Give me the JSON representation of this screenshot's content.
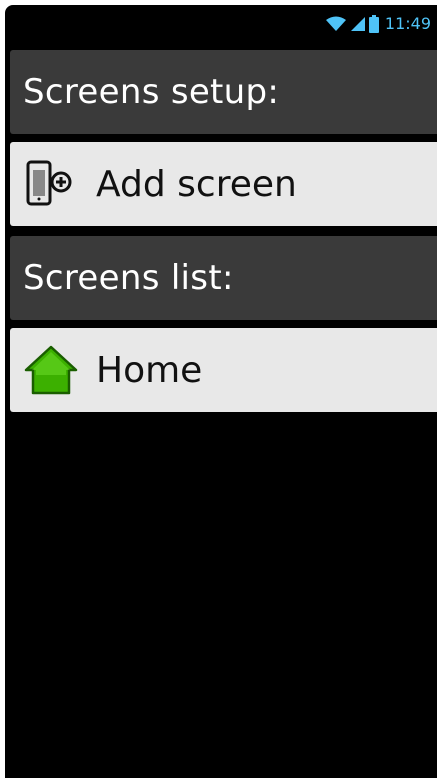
{
  "status_bar": {
    "time": "11:49",
    "wifi_icon": "wifi-icon",
    "signal_icon": "signal-icon",
    "battery_icon": "battery-icon",
    "accent_color": "#4fc3f7"
  },
  "setup_section": {
    "title": "Screens setup:"
  },
  "add_screen": {
    "label": "Add screen",
    "icon": "add-phone-icon"
  },
  "list_section": {
    "title": "Screens list:"
  },
  "screens": [
    {
      "label": "Home",
      "icon": "home-icon",
      "icon_color": "#3cb000"
    }
  ]
}
